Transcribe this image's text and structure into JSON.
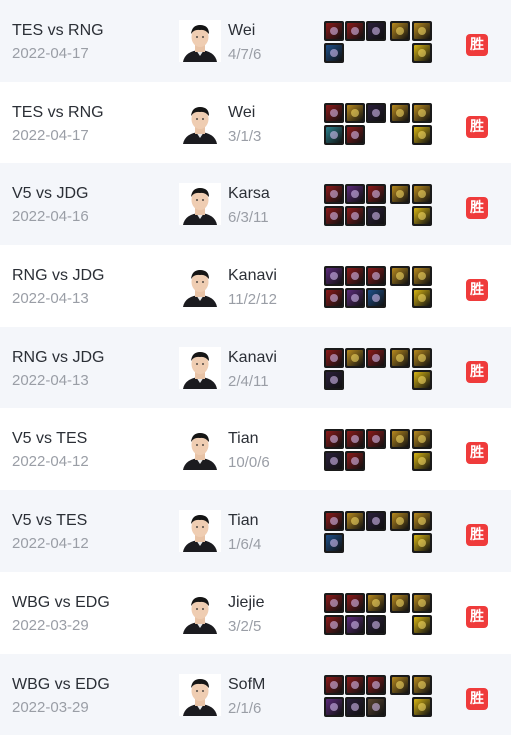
{
  "result_label": "胜",
  "matches": [
    {
      "match": "TES vs RNG",
      "date": "2022-04-17",
      "player": "Wei",
      "kda": "4/7/6",
      "result": "胜",
      "items_top": [
        "red",
        "red",
        "dark",
        "gold",
        "gold"
      ],
      "items_bot": [
        "blue",
        "yellow"
      ]
    },
    {
      "match": "TES vs RNG",
      "date": "2022-04-17",
      "player": "Wei",
      "kda": "3/1/3",
      "result": "胜",
      "items_top": [
        "red",
        "gold",
        "dark",
        "gold",
        "gold"
      ],
      "items_bot": [
        "teal",
        "red",
        "yellow"
      ]
    },
    {
      "match": "V5 vs JDG",
      "date": "2022-04-16",
      "player": "Karsa",
      "kda": "6/3/11",
      "result": "胜",
      "items_top": [
        "red",
        "purple",
        "red",
        "gold",
        "gold"
      ],
      "items_bot": [
        "red",
        "red",
        "dark",
        "yellow"
      ]
    },
    {
      "match": "RNG vs JDG",
      "date": "2022-04-13",
      "player": "Kanavi",
      "kda": "11/2/12",
      "result": "胜",
      "items_top": [
        "purple",
        "red",
        "red",
        "gold",
        "gold"
      ],
      "items_bot": [
        "red",
        "purple",
        "blue",
        "yellow"
      ]
    },
    {
      "match": "RNG vs JDG",
      "date": "2022-04-13",
      "player": "Kanavi",
      "kda": "2/4/11",
      "result": "胜",
      "items_top": [
        "red",
        "gold",
        "red",
        "gold",
        "gold"
      ],
      "items_bot": [
        "dark",
        "yellow"
      ]
    },
    {
      "match": "V5 vs TES",
      "date": "2022-04-12",
      "player": "Tian",
      "kda": "10/0/6",
      "result": "胜",
      "items_top": [
        "red",
        "red",
        "red",
        "gold",
        "gold"
      ],
      "items_bot": [
        "dark",
        "red",
        "yellow"
      ]
    },
    {
      "match": "V5 vs TES",
      "date": "2022-04-12",
      "player": "Tian",
      "kda": "1/6/4",
      "result": "胜",
      "items_top": [
        "red",
        "gold",
        "dark",
        "gold",
        "gold"
      ],
      "items_bot": [
        "blue",
        "yellow"
      ]
    },
    {
      "match": "WBG vs EDG",
      "date": "2022-03-29",
      "player": "Jiejie",
      "kda": "3/2/5",
      "result": "胜",
      "items_top": [
        "red",
        "red",
        "gold",
        "gold",
        "gold"
      ],
      "items_bot": [
        "red",
        "purple",
        "dark",
        "yellow"
      ]
    },
    {
      "match": "WBG vs EDG",
      "date": "2022-03-29",
      "player": "SofM",
      "kda": "2/1/6",
      "result": "胜",
      "items_top": [
        "red",
        "red",
        "red",
        "gold",
        "gold"
      ],
      "items_bot": [
        "purple",
        "dark",
        "brown",
        "yellow"
      ]
    }
  ],
  "item_palette": {
    "red": "#8c1a1a",
    "gold": "#b88a1e",
    "dark": "#2a1f3a",
    "purple": "#5b2a7a",
    "blue": "#1d4f8a",
    "teal": "#2a7f8c",
    "yellow": "#d7b413",
    "brown": "#5a4530"
  }
}
